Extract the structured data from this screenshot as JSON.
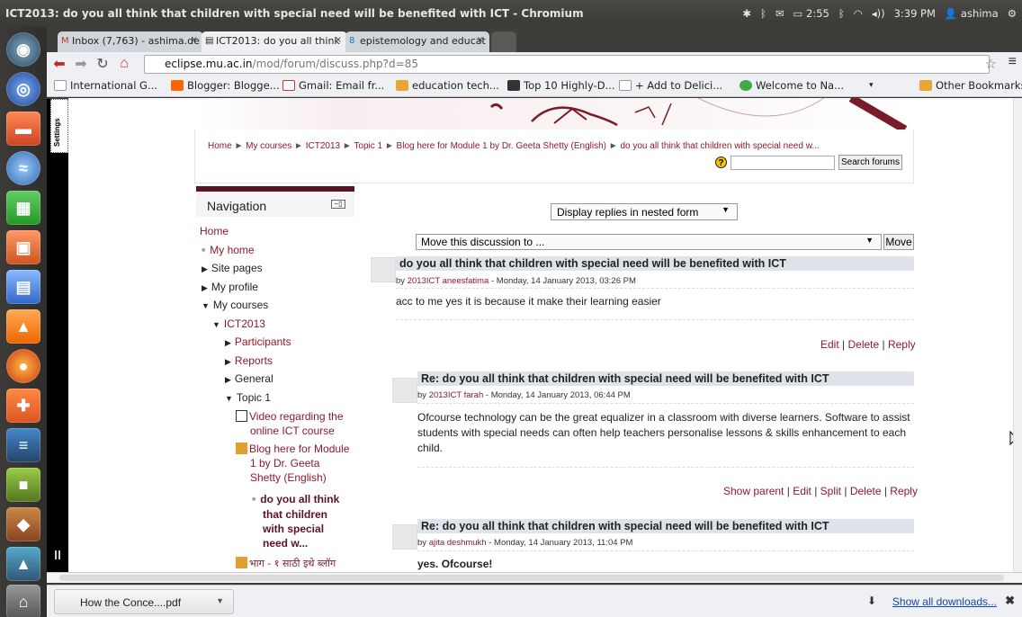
{
  "window": {
    "title": "ICT2013: do you all think that children with special need will be benefited with ICT - Chromium"
  },
  "panel": {
    "battery": "2:55",
    "time": "3:39 PM",
    "user": "ashima"
  },
  "tabs": [
    {
      "label": "Inbox (7,763) - ashima.de"
    },
    {
      "label": "ICT2013: do you all think"
    },
    {
      "label": "epistemology and educat"
    }
  ],
  "address": {
    "host": "eclipse.mu.ac.in",
    "path": "/mod/forum/discuss.php?d=85"
  },
  "bookmarks": [
    {
      "label": "International G..."
    },
    {
      "label": "Blogger: Blogge..."
    },
    {
      "label": "Gmail: Email fr..."
    },
    {
      "label": "education tech..."
    },
    {
      "label": "Top 10 Highly-D..."
    },
    {
      "label": "+ Add to Delici..."
    },
    {
      "label": "Welcome to Na..."
    },
    {
      "label": "Other Bookmarks"
    }
  ],
  "settings_tab": "Settings",
  "breadcrumb": [
    "Home",
    "My courses",
    "ICT2013",
    "Topic 1",
    "Blog here for Module 1 by Dr. Geeta Shetty (English)",
    "do you all think that children with special need w..."
  ],
  "search": {
    "button": "Search forums",
    "help": "?"
  },
  "navigation": {
    "title": "Navigation",
    "items": [
      "Home",
      "My home",
      "Site pages",
      "My profile",
      "My courses",
      "ICT2013",
      "Participants",
      "Reports",
      "General",
      "Topic 1"
    ],
    "video_lines": [
      "Video regarding the",
      "online ICT course"
    ],
    "blog_lines": [
      "Blog here for Module",
      "1 by Dr. Geeta",
      "Shetty (English)"
    ],
    "current_lines": [
      "do you all think",
      "that children",
      "with special",
      "need w..."
    ],
    "hindi": "भाग - १ साठी इथे ब्लॉग"
  },
  "controls": {
    "display_mode": "Display replies in nested form",
    "move_to": "Move this discussion to ...",
    "move_button": "Move"
  },
  "posts": [
    {
      "subject": "do you all think that children with special need will be benefited with ICT",
      "by": "by",
      "author": "2013ICT aneesfatima",
      "date": " - Monday, 14 January 2013, 03:26 PM",
      "body": "acc to me yes it is because it make their learning easier",
      "links": [
        "Edit",
        "Delete",
        "Reply"
      ]
    },
    {
      "subject": "Re: do you all think that children with special need will be benefited with ICT",
      "by": "by",
      "author": "2013ICT farah",
      "date": " - Monday, 14 January 2013, 06:44 PM",
      "body": "Ofcourse technology can be the great equalizer in a classroom with diverse learners. Software to assist students with special needs can often help teachers personalise lessons & skills enhancement to each child.",
      "links": [
        "Show parent",
        "Edit",
        "Split",
        "Delete",
        "Reply"
      ]
    },
    {
      "subject": "Re: do you all think that children with special need will be benefited with ICT",
      "by": "by",
      "author": "ajita deshmukh",
      "date": " - Monday, 14 January 2013, 11:04 PM",
      "body": "yes. Ofcourse!",
      "links": []
    }
  ],
  "downloads": {
    "file": "How the Conce....pdf",
    "show_all": "Show all downloads..."
  },
  "colors": {
    "accent": "#8b1a2d",
    "nav_bar": "#5a1323",
    "subject_bg": "#dde3e8"
  }
}
